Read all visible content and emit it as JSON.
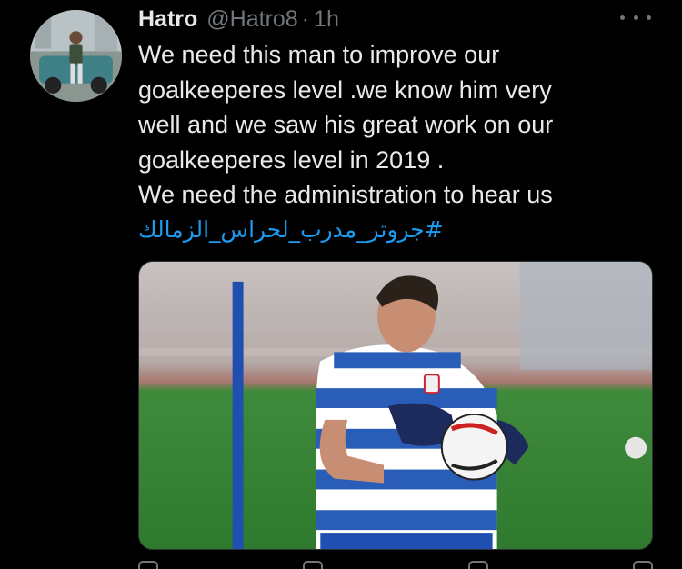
{
  "tweet": {
    "display_name": "Hatro",
    "handle": "@Hatro8",
    "separator": "·",
    "time": "1h",
    "text_lines": [
      "We need this man to improve our",
      "goalkeeperes level .we know him very",
      "well and we saw his great work on our",
      "goalkeeperes level in 2019 .",
      "We need the administration to hear us"
    ],
    "hashtag": "#جروتر_مدرب_لحراس_الزمالك",
    "more_icon": "more-horizontal-icon"
  },
  "colors": {
    "background": "#000000",
    "text": "#e7e9ea",
    "secondary": "#71767b",
    "link": "#1d9bf0"
  }
}
